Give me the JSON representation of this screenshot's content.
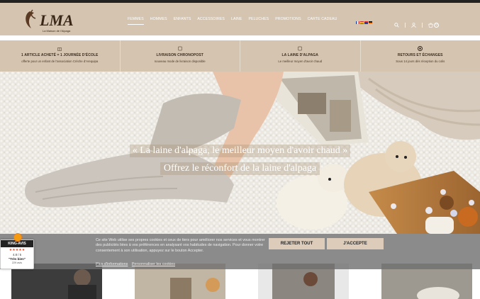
{
  "brand": {
    "name": "LMA",
    "tagline": "La Maison de l'Alpaga"
  },
  "nav": {
    "items": [
      {
        "label": "FEMMES",
        "active": true
      },
      {
        "label": "HOMMES"
      },
      {
        "label": "ENFANTS"
      },
      {
        "label": "ACCESSOIRES"
      },
      {
        "label": "LAINE"
      },
      {
        "label": "PELUCHES"
      },
      {
        "label": "PROMOTIONS"
      },
      {
        "label": "CARTE CADEAU"
      }
    ]
  },
  "header_icons": {
    "flags": [
      "flag-fr",
      "flag-es",
      "flag-uk",
      "flag-de"
    ],
    "cart_count": "0"
  },
  "features": [
    {
      "title": "1 ARTICLE ACHETÉ = 1 JOURNÉE D'ÉCOLE",
      "subtitle": "offerte pour un enfant de l'association Crèche d'Arequipa",
      "icon": "gift-icon"
    },
    {
      "title": "LIVRAISON CHRONOPOST",
      "subtitle": "nouveau mode de livraison disponible",
      "icon": "truck-icon"
    },
    {
      "title": "LA LAINE D'ALPAGA",
      "subtitle": "Le meilleur moyen d'avoir chaud",
      "icon": "wool-icon"
    },
    {
      "title": "RETOURS ET ÉCHANGES",
      "subtitle": "Sous 14 jours dès réception du colis",
      "icon": "return-icon"
    }
  ],
  "hero": {
    "title": "« La laine d'alpaga, le meilleur moyen d'avoir chaud »",
    "subtitle": "Offrez le réconfort de la laine d'alpaga"
  },
  "cookie": {
    "text": "Ce site Web utilise ses propres cookies et ceux de tiers pour améliorer nos services et vous montrer des publicités liées à vos préférences en analysant vos habitudes de navigation. Pour donner votre consentement à son utilisation, appuyez sur le bouton Accepter.",
    "more_info": "Plus d'informations",
    "customize": "Personnaliser les cookies",
    "reject_label": "REJETER TOUT",
    "accept_label": "J'ACCEPTE"
  },
  "kingavis": {
    "title": "KING-AVIS",
    "stars": "★★★★★",
    "score": "4.8 / 5",
    "label": "\"Très bien\"",
    "count": "229 avis"
  },
  "colors": {
    "header_bg": "#d4c4b0",
    "accent": "#dcccb9",
    "topbar": "#222222"
  }
}
